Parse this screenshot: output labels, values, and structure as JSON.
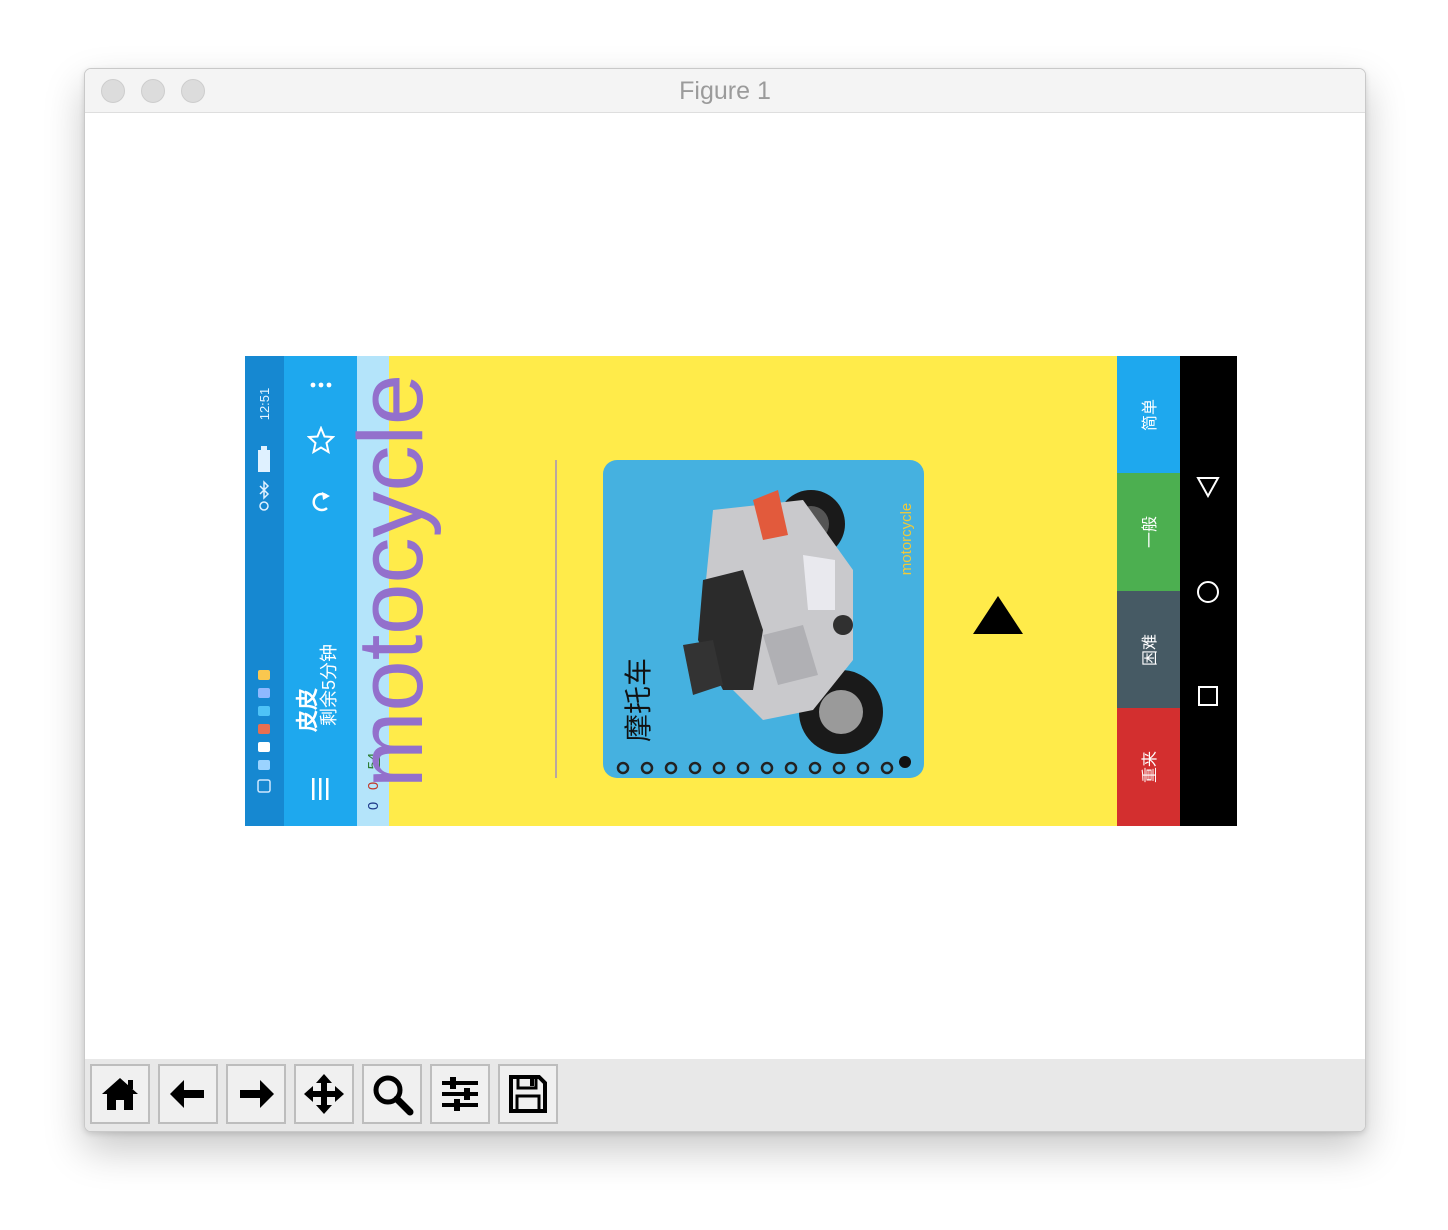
{
  "window": {
    "title": "Figure 1"
  },
  "phone": {
    "status_bar": {
      "time": "12:51"
    },
    "app_bar": {
      "title": "皮皮",
      "subtitle": "剩余5分钟",
      "more_icon": "more-icon",
      "star_icon": "star-icon",
      "refresh_icon": "refresh-icon",
      "menu_icon": "menu-icon"
    },
    "score": {
      "a": "0",
      "b": "0",
      "c": "54"
    },
    "card": {
      "word": "motocycle",
      "picture_english": "motorcycle",
      "picture_chinese": "摩托车"
    },
    "difficulty_buttons": [
      {
        "label": "简单",
        "color": "#1ea8ee"
      },
      {
        "label": "一般",
        "color": "#4caf50"
      },
      {
        "label": "困难",
        "color": "#465a64"
      },
      {
        "label": "重来",
        "color": "#d32f2f"
      }
    ],
    "nav_bar": {
      "back_icon": "back-triangle-icon",
      "home_icon": "home-circle-icon",
      "recents_icon": "recents-square-icon"
    }
  },
  "colors": {
    "word": "#9370cc",
    "page_bg": "#ffeb4a",
    "photo_bg": "#45b1e0"
  }
}
